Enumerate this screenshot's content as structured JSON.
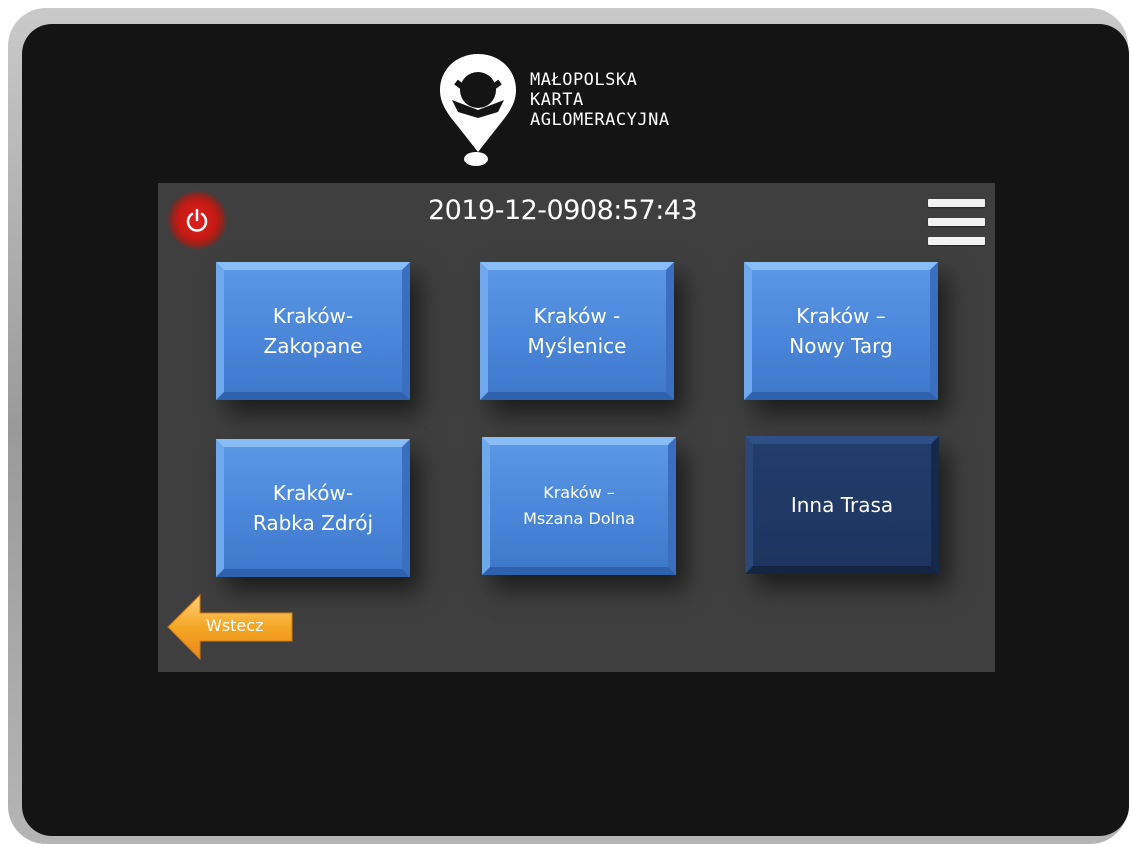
{
  "brand": {
    "lines": [
      "MAŁOPOLSKA",
      "KARTA",
      "AGLOMERACYJNA"
    ]
  },
  "header": {
    "date": "2019-12-09",
    "time": "08:57:43",
    "power_icon": "power-icon",
    "menu_icon": "hamburger-menu-icon"
  },
  "routes": [
    {
      "label": "Kraków-\nZakopane"
    },
    {
      "label": "Kraków -\nMyślenice"
    },
    {
      "label": "Kraków –\nNowy Targ"
    },
    {
      "label": "Kraków-\nRabka Zdrój"
    },
    {
      "label": "Kraków –\nMszana Dolna"
    },
    {
      "label": "Inna Trasa"
    }
  ],
  "footer": {
    "back_label": "Wstecz",
    "back_icon": "arrow-left-icon"
  },
  "colors": {
    "button_blue": "#4a86d9",
    "button_selected": "#1d355f",
    "panel": "#3f3f3f",
    "power_red": "#c41a12",
    "back_orange": "#f5a623"
  }
}
